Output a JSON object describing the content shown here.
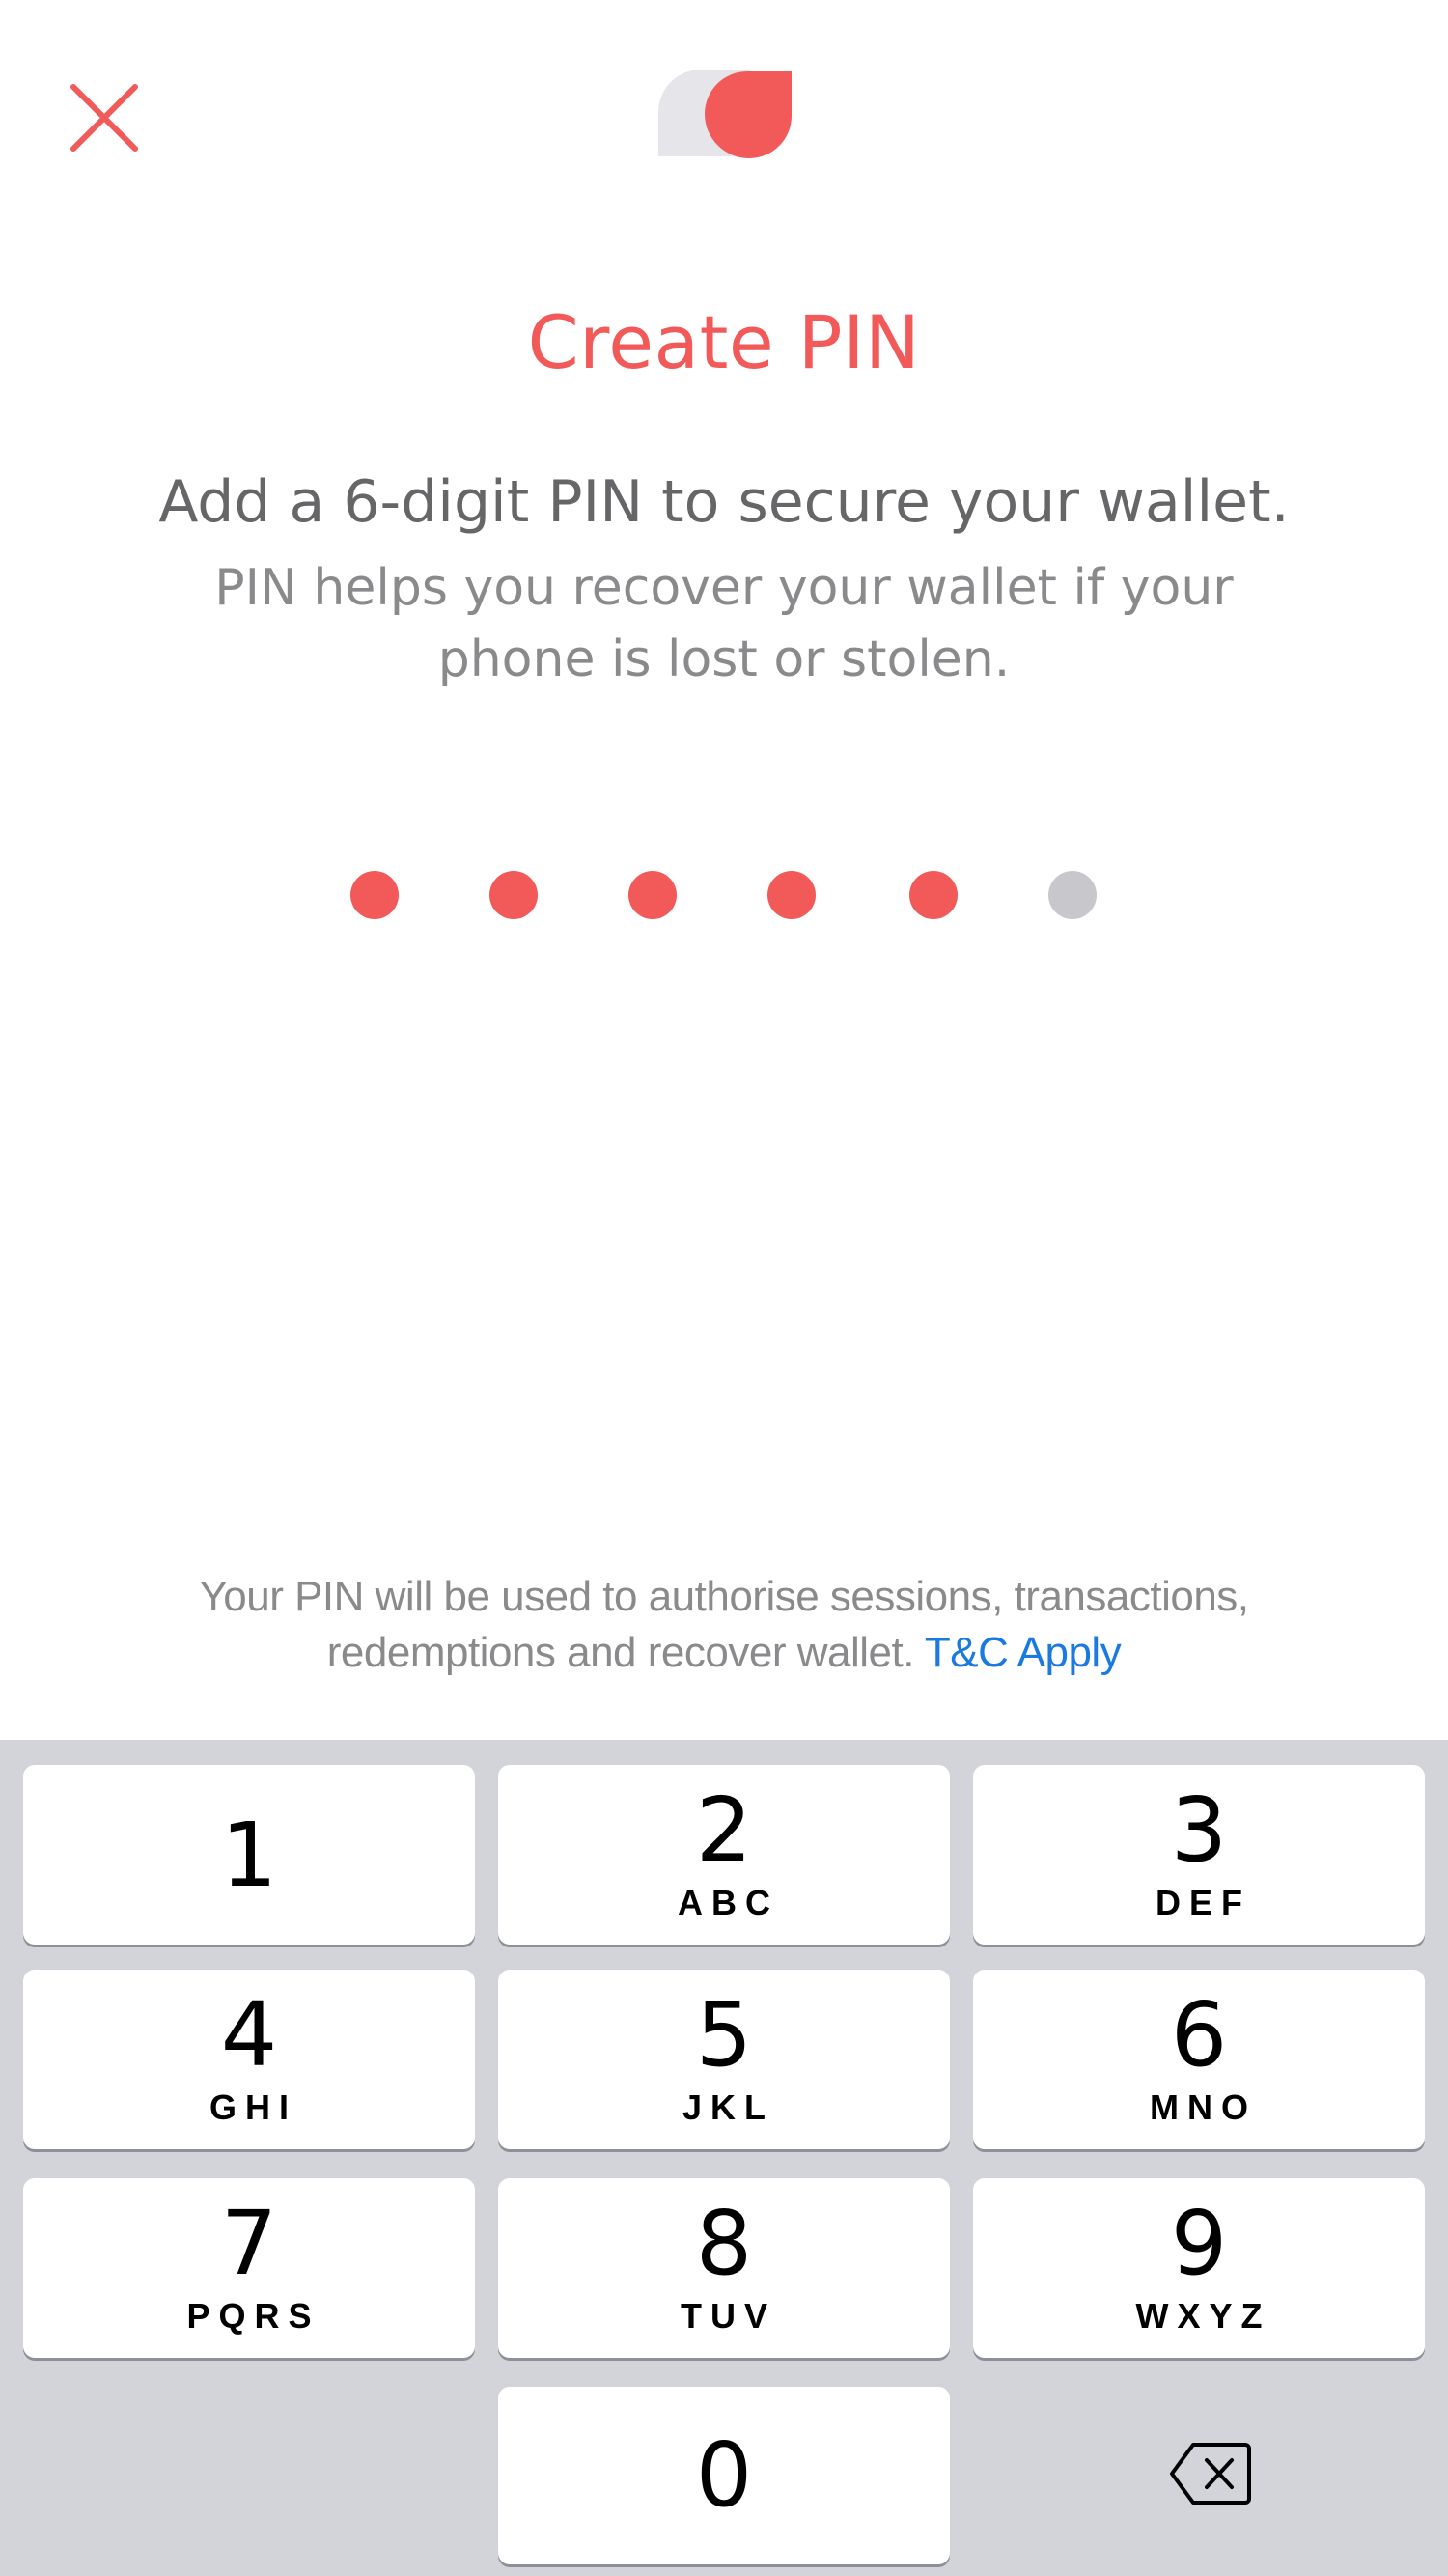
{
  "header": {
    "close_icon": "close-icon",
    "logo_icon": "app-logo-icon"
  },
  "title": "Create PIN",
  "subtitle": "Add a 6-digit PIN to secure your wallet.",
  "helper": "PIN helps you recover your wallet if your phone is lost or stolen.",
  "pin": {
    "length": 6,
    "filled": 5,
    "colors": {
      "filled": "#f25a5a",
      "empty": "#c8c7cc"
    }
  },
  "terms": {
    "text": "Your PIN will be used to authorise sessions, transactions, redemptions and recover wallet. ",
    "link": "T&C Apply"
  },
  "keypad": {
    "keys": [
      {
        "digit": "1",
        "letters": ""
      },
      {
        "digit": "2",
        "letters": "ABC"
      },
      {
        "digit": "3",
        "letters": "DEF"
      },
      {
        "digit": "4",
        "letters": "GHI"
      },
      {
        "digit": "5",
        "letters": "JKL"
      },
      {
        "digit": "6",
        "letters": "MNO"
      },
      {
        "digit": "7",
        "letters": "PQRS"
      },
      {
        "digit": "8",
        "letters": "TUV"
      },
      {
        "digit": "9",
        "letters": "WXYZ"
      },
      {
        "digit": "0",
        "letters": ""
      }
    ],
    "backspace_icon": "backspace-icon"
  },
  "colors": {
    "accent": "#f25a5a",
    "link": "#1a7ae0",
    "keypad_bg": "#d2d4da"
  }
}
